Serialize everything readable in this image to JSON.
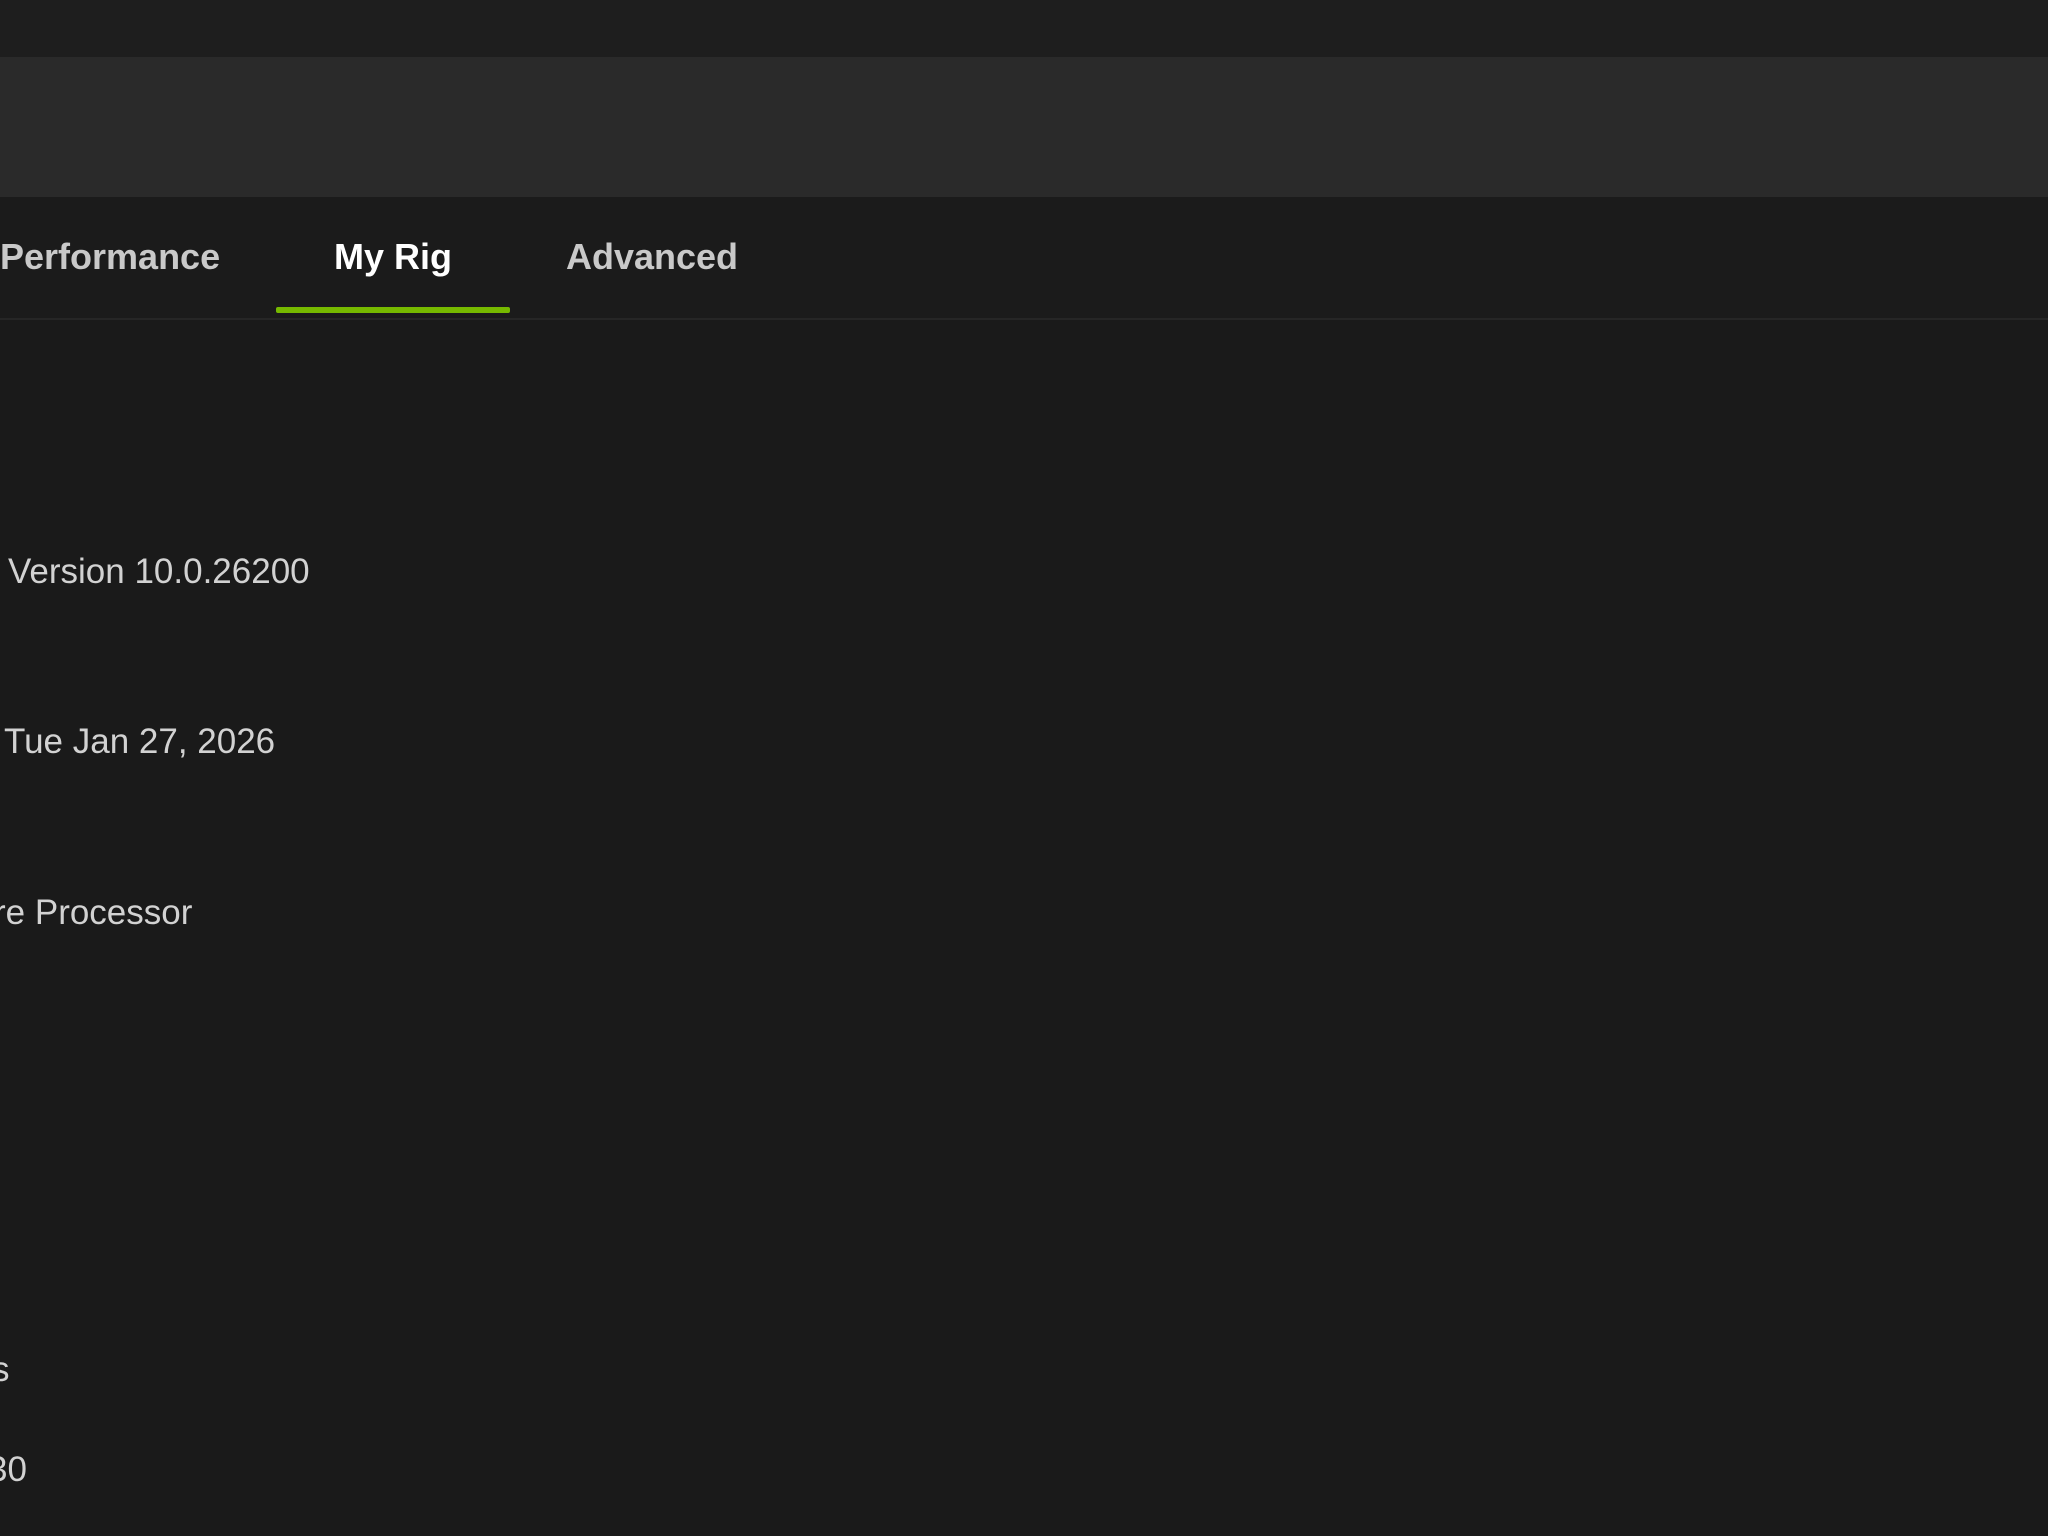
{
  "tabs": [
    {
      "label": "Performance",
      "active": false
    },
    {
      "label": "My Rig",
      "active": true
    },
    {
      "label": "Advanced",
      "active": false
    }
  ],
  "accent_color": "#76b900",
  "system_info": {
    "os_version": "Version 10.0.26200",
    "date": "Tue Jan 27, 2026",
    "cpu": "re Processor",
    "fragment_1": "s",
    "fragment_2": "30"
  }
}
